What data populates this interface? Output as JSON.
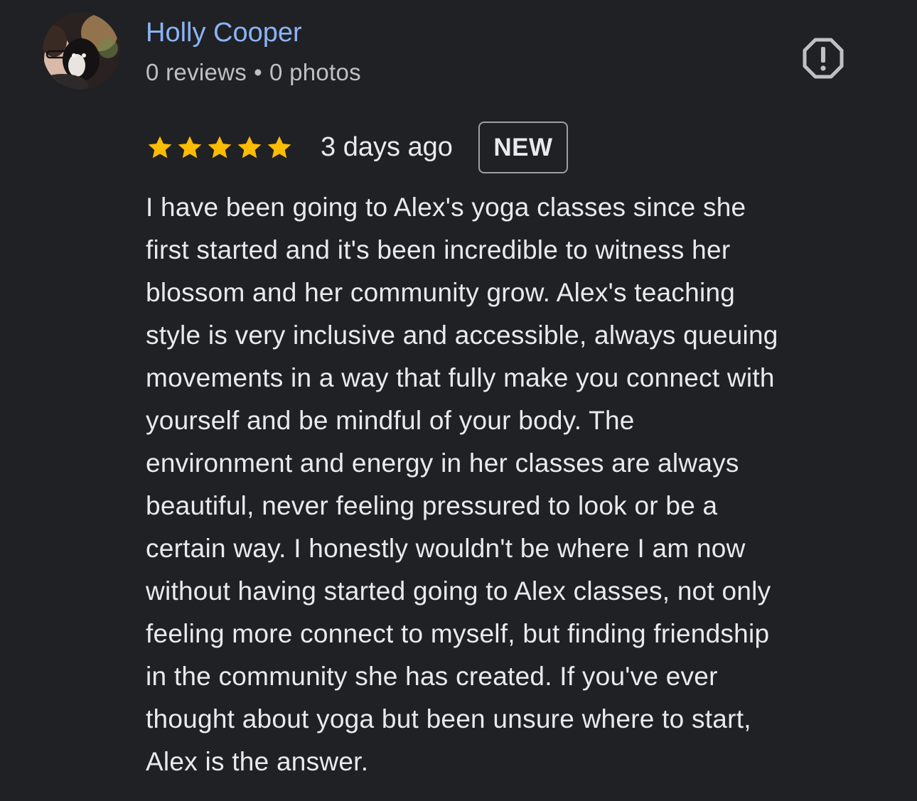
{
  "reviewer": {
    "name": "Holly Cooper",
    "reviews": "0 reviews",
    "separator": "•",
    "photos": "0 photos",
    "avatar_icon": "profile-photo"
  },
  "report_icon": "report-flag-icon",
  "rating": {
    "stars": 5,
    "max_stars": 5,
    "star_color": "#fbbc04",
    "time_ago": "3 days ago",
    "badge": "NEW"
  },
  "review_lines": [
    "I have been going to Alex's yoga classes since she",
    "first started and it's been incredible to witness her",
    "blossom and her community grow. Alex's teaching",
    "style is very inclusive and accessible, always queuing",
    "movements in a way that fully make you connect with",
    "yourself and be mindful of your body. The",
    "environment and energy in her classes are always",
    "beautiful, never feeling pressured to look or be a",
    "certain way. I honestly wouldn't be where I am now",
    "without having started going to Alex classes, not only",
    "feeling more connect to myself, but finding friendship",
    "in the community she has created. If you've ever",
    "thought about yoga but been unsure where to start,",
    "Alex is the answer."
  ],
  "colors": {
    "background": "#202124",
    "name": "#8ab4f8",
    "text": "#e8eaed",
    "secondary_text": "#bdc1c6"
  }
}
